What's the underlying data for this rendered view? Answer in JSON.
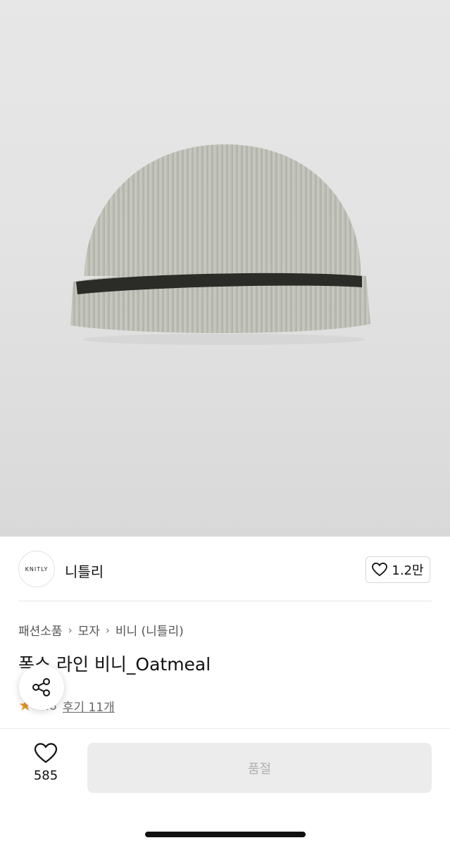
{
  "product_image": {
    "alt": "product-photo"
  },
  "brand": {
    "logo_text": "KNITLY",
    "name": "니틀리"
  },
  "like": {
    "icon": "heart-icon",
    "count": "1.2만"
  },
  "breadcrumb": {
    "items": [
      "패션소품",
      "모자",
      "비니 (니틀리)"
    ],
    "separator_icon": "chevron-right-icon"
  },
  "product": {
    "title": "폭스 라인 비니_Oatmeal"
  },
  "rating": {
    "score": "4.8",
    "reviews": "후기 11개",
    "icon": "star-icon"
  },
  "share": {
    "icon": "share-icon"
  },
  "bottom": {
    "wish_icon": "heart-icon",
    "wish_count": "585",
    "buy_label": "품절"
  },
  "colors": {
    "star": "#e8952b",
    "soldout_bg": "#ececec",
    "soldout_text": "#b0b0b0"
  }
}
